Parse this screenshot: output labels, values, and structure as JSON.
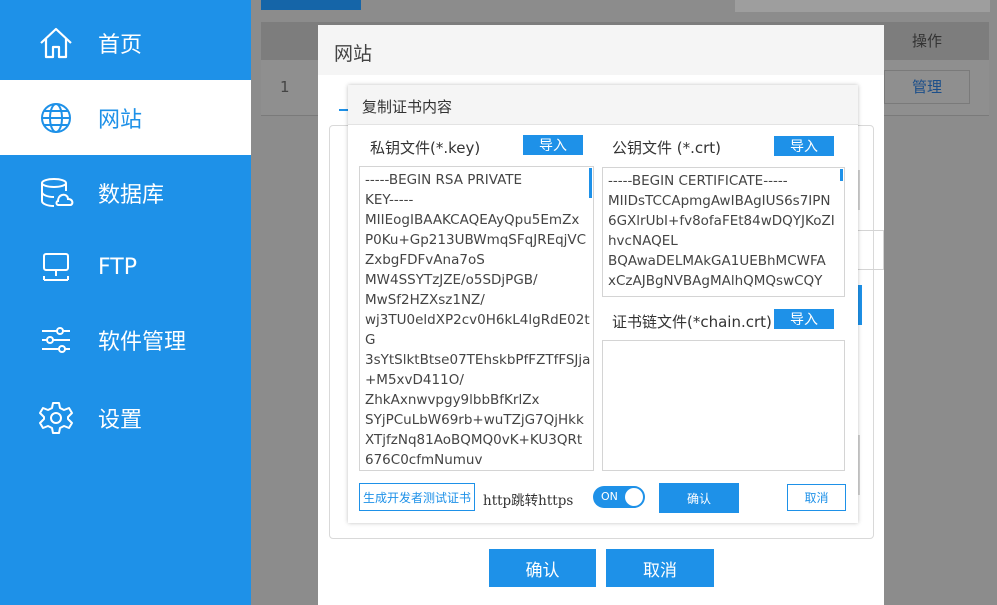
{
  "sidebar": {
    "items": [
      {
        "label": "首页",
        "icon": "home-icon",
        "active": false
      },
      {
        "label": "网站",
        "icon": "globe-icon",
        "active": true
      },
      {
        "label": "数据库",
        "icon": "database-icon",
        "active": false
      },
      {
        "label": "FTP",
        "icon": "ftp-server-icon",
        "active": false
      },
      {
        "label": "软件管理",
        "icon": "sliders-icon",
        "active": false
      },
      {
        "label": "设置",
        "icon": "gear-icon",
        "active": false
      }
    ]
  },
  "background_table": {
    "op_header": "操作",
    "row_no": "1",
    "manage_label": "管理"
  },
  "site_dialog": {
    "title": "网站",
    "ok_label": "确认",
    "cancel_label": "取消"
  },
  "cert_dialog": {
    "title": "复制证书内容",
    "key_label": "私钥文件(*.key)",
    "crt_label": "公钥文件 (*.crt)",
    "chain_label": "证书链文件(*chain.crt)",
    "import_label": "导入",
    "key_content": "-----BEGIN RSA PRIVATE\nKEY-----\nMIIEogIBAAKCAQEAyQpu5EmZx\nP0Ku+Gp213UBWmqSFqJREqjVC\nZxbgFDFvAna7oS\nMW4SSYTzJZE/o5SDjPGB/\nMwSf2HZXsz1NZ/\nwj3TU0eldXP2cv0H6kL4lgRdE02t\nG\n3sYtSlktBtse07TEhskbPfFZTfFSJja\n+M5xvD411O/\nZhkAxnwvpgy9lbbBfKrlZx\nSYjPCuLbW69rb+wuTZjG7QjHkk\nXTjfzNq81AoBQMQ0vK+KU3QRt\n676C0cfmNumuv",
    "crt_content": "-----BEGIN CERTIFICATE-----\nMIIDsTCCApmgAwIBAgIUS6s7IPN\n6GXlrUbI+fv8ofaFEt84wDQYJKoZI\nhvcNAQEL\nBQAwaDELMAkGA1UEBhMCWFA\nxCzAJBgNVBAgMAlhQMQswCQY",
    "chain_content": "",
    "gen_test_cert_label": "生成开发者测试证书",
    "redirect_label": "http跳转https",
    "toggle_label": "ON",
    "confirm_label": "确认",
    "cancel_label": "取消"
  },
  "colors": {
    "primary": "#1e91e8",
    "sidebar_bg": "#1e91e8",
    "overlay": "#8c8c8c"
  }
}
